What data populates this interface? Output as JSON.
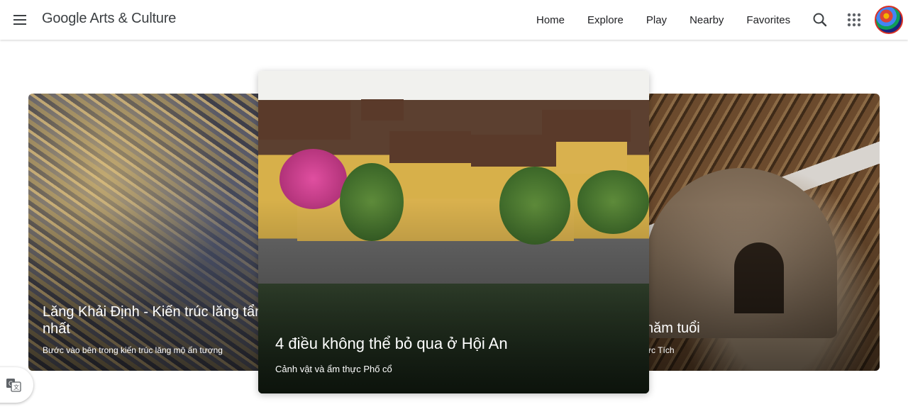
{
  "header": {
    "brand": "Google Arts & Culture",
    "nav": [
      "Home",
      "Explore",
      "Play",
      "Nearby",
      "Favorites"
    ],
    "icons": [
      "menu-icon",
      "search-icon",
      "apps-icon"
    ]
  },
  "cards": {
    "left": {
      "title": "Lăng Khải Định - Kiến trúc lăng tẩm nhất",
      "subtitle": "Bước vào bên trong kiến trúc lăng mộ ấn tượng"
    },
    "center": {
      "title": "4 điều không thể bỏ qua ở Hội An",
      "subtitle": "Cảnh vật và ẩm thực Phố cổ"
    },
    "right": {
      "title": "năm tuổi",
      "subtitle": "ức Tích"
    }
  },
  "colors": {
    "text": "#202124",
    "brand_text": "#3c4043",
    "avatar_ring": "#d93025"
  }
}
